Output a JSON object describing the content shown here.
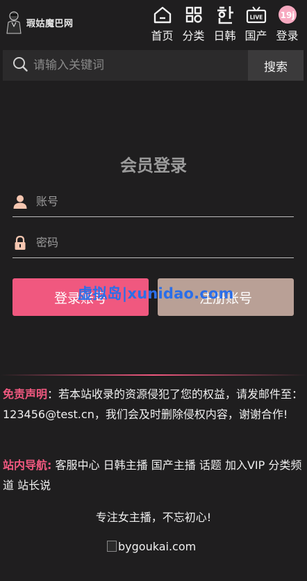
{
  "header": {
    "logo_text": "瑕姑魔巴网",
    "logo_sub": "",
    "nav": [
      {
        "label": "首页",
        "icon": "home-icon"
      },
      {
        "label": "分类",
        "icon": "grid-icon"
      },
      {
        "label": "日韩",
        "icon": "hangul-icon"
      },
      {
        "label": "国产",
        "icon": "live-tv-icon"
      },
      {
        "label": "登录",
        "icon": "avatar-icon"
      }
    ]
  },
  "search": {
    "placeholder": "请输入关键词",
    "button_label": "搜索"
  },
  "login": {
    "title": "会员登录",
    "username_placeholder": "账号",
    "password_placeholder": "密码",
    "login_button": "登录账号",
    "register_button": "注册账号"
  },
  "watermark": "虚拟岛|xunidao.com",
  "footer": {
    "disclaimer_label": "免责声明",
    "disclaimer_text": "：若本站收录的资源侵犯了您的权益，请发邮件至：123456@test.cn，我们会及时删除侵权内容，谢谢合作!",
    "sitenav_label": "站内导航:",
    "sitenav_links": [
      "客服中心",
      "日韩主播",
      "国产主播",
      "话题",
      "加入VIP",
      "分类频道",
      "站长说"
    ],
    "slogan": "专注女主播，不忘初心!",
    "image_alt": "bygoukai.com"
  },
  "colors": {
    "accent_pink": "#f0587f",
    "register_tan": "#b9a096",
    "background": "#1f1e1f",
    "watermark_blue": "#2b6ee8"
  }
}
